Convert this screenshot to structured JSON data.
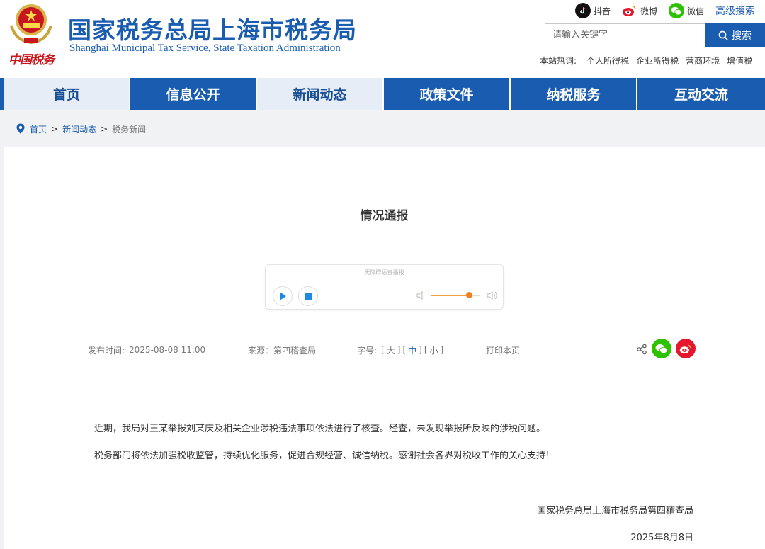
{
  "header": {
    "site_title": "国家税务总局上海市税务局",
    "site_subtitle": "Shanghai Municipal Tax Service, State Taxation Administration",
    "brand_script": "中国税务",
    "social": [
      {
        "label": "抖音",
        "icon": "douyin-icon"
      },
      {
        "label": "微博",
        "icon": "weibo-icon"
      },
      {
        "label": "微信",
        "icon": "wechat-icon"
      }
    ],
    "advanced_search": "高级搜索",
    "search": {
      "placeholder": "请输入关键字",
      "button_label": "搜索"
    },
    "hot": {
      "label": "本站热词:",
      "items": [
        "个人所得税",
        "企业所得税",
        "营商环境",
        "增值税"
      ]
    }
  },
  "nav": {
    "items": [
      {
        "label": "首页"
      },
      {
        "label": "信息公开"
      },
      {
        "label": "新闻动态"
      },
      {
        "label": "政策文件"
      },
      {
        "label": "纳税服务"
      },
      {
        "label": "互动交流"
      }
    ]
  },
  "breadcrumb": {
    "home": "首页",
    "section": "新闻动态",
    "current": "税务新闻",
    "separator": ">"
  },
  "article": {
    "title": "情况通报",
    "player_label": "无障碍语音播报",
    "publish_time_label": "发布时间:",
    "publish_time": "2025-08-08 11:00",
    "source_label": "来源：",
    "source": "第四稽查局",
    "font_size_label": "字号:",
    "font_large": "大",
    "font_medium": "中",
    "font_small": "小",
    "print": "打印本页",
    "paragraphs": [
      "近期，我局对王某举报刘某庆及相关企业涉税违法事项依法进行了核查。经查，未发现举报所反映的涉税问题。",
      "税务部门将依法加强税收监管，持续优化服务，促进合规经营、诚信纳税。感谢社会各界对税收工作的关心支持！"
    ],
    "signature": "国家税务总局上海市税务局第四稽查局",
    "date": "2025年8月8日"
  },
  "colors": {
    "brand_blue": "#1a5cb0",
    "wechat_green": "#2dc100",
    "weibo_red": "#e6162d"
  }
}
